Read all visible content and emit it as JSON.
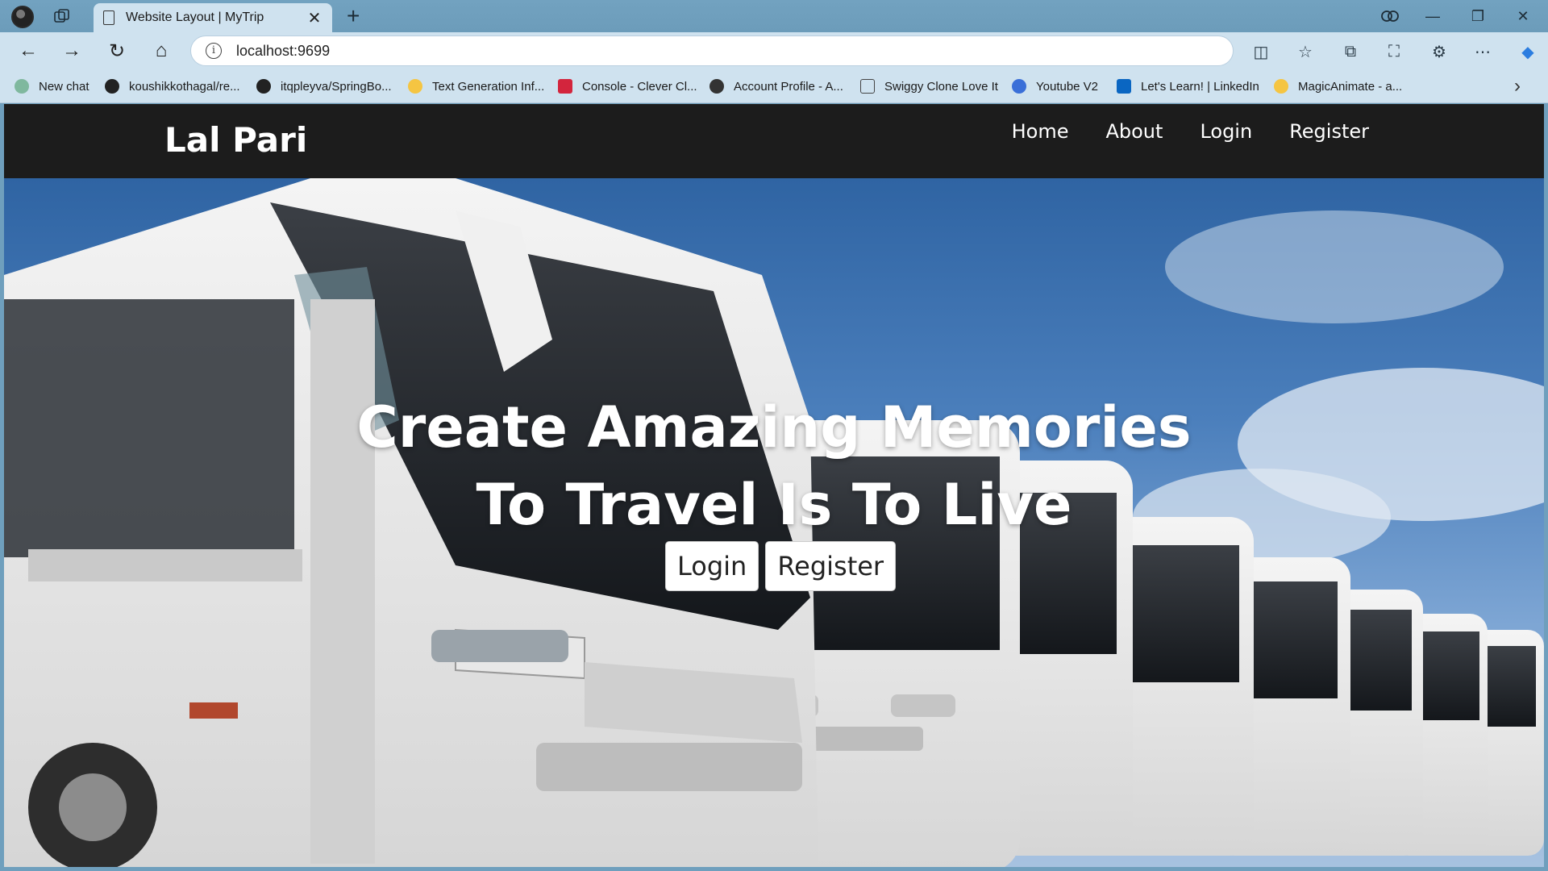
{
  "browser": {
    "tab_title": "Website Layout | MyTrip",
    "url": "localhost:9699",
    "bookmarks": [
      {
        "label": "New chat",
        "icon": "openai-icon"
      },
      {
        "label": "koushikkothagal/re...",
        "icon": "github-icon"
      },
      {
        "label": "itqpleyva/SpringBo...",
        "icon": "github-icon"
      },
      {
        "label": "Text Generation Inf...",
        "icon": "huggingface-icon"
      },
      {
        "label": "Console - Clever Cl...",
        "icon": "clevercloud-icon"
      },
      {
        "label": "Account Profile - A...",
        "icon": "account-icon"
      },
      {
        "label": "Swiggy Clone Love It",
        "icon": "page-icon"
      },
      {
        "label": "Youtube V2",
        "icon": "search-icon"
      },
      {
        "label": "Let's Learn! | LinkedIn",
        "icon": "linkedin-icon"
      },
      {
        "label": "MagicAnimate - a...",
        "icon": "huggingface-icon"
      }
    ],
    "accent": "#cfe2ef"
  },
  "site": {
    "brand": "Lal Pari",
    "nav": [
      "Home",
      "About",
      "Login",
      "Register"
    ],
    "hero": {
      "line1": "Create Amazing Memories",
      "line2": "To Travel Is To Live",
      "login_label": "Login",
      "register_label": "Register"
    },
    "navbar_color": "#1c1c1c"
  }
}
